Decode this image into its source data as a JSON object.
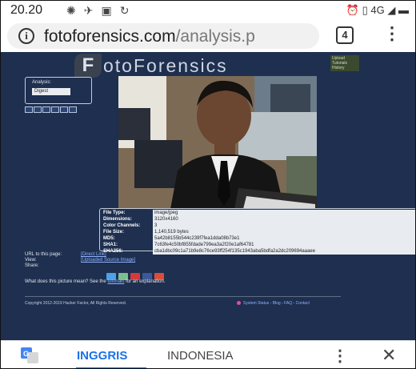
{
  "status_bar": {
    "time": "20.20",
    "network": "4G"
  },
  "address_bar": {
    "url_host": "fotoforensics.com",
    "url_path": "/analysis.p",
    "tab_count": "4"
  },
  "site": {
    "logo_letter": "F",
    "logo_word": "otoForensics",
    "top_links": [
      "Upload",
      "Tutorials",
      "History"
    ]
  },
  "analysis": {
    "label": "Analysis:",
    "selected": "Digest"
  },
  "file_info": {
    "rows": [
      {
        "key": "File Type:",
        "value": "image/jpeg"
      },
      {
        "key": "Dimensions:",
        "value": "3120x4160"
      },
      {
        "key": "Color Channels:",
        "value": "3"
      },
      {
        "key": "File Size:",
        "value": "1,140,519 bytes"
      },
      {
        "key": "MD5:",
        "value": "5a42b8155b544c239f7fea1dda08b73e1"
      },
      {
        "key": "SHA1:",
        "value": "7c63fe4c50bf855fdade799ea3a2f20e1af64781"
      },
      {
        "key": "SHA256:",
        "value": "cba1dbc09c1a71b9e8c76ce93ff254f135c1943aba5bdfa2a2dc209694aaaee"
      }
    ]
  },
  "links": {
    "url_label": "URL to this page:",
    "url_link": "[Direct Link]",
    "view_label": "View:",
    "view_link": "[Uploaded Source Image]",
    "share_label": "Share:",
    "share_icons": [
      {
        "name": "twitter",
        "color": "#4aa3e8"
      },
      {
        "name": "email",
        "color": "#7bbf8e"
      },
      {
        "name": "pinterest",
        "color": "#d43a3a"
      },
      {
        "name": "facebook",
        "color": "#3b5998"
      },
      {
        "name": "google-plus",
        "color": "#dd4b39"
      }
    ],
    "explain_prefix": "What does this picture mean? See the ",
    "explain_link": "tutorials",
    "explain_suffix": " for an explanation."
  },
  "footer": {
    "copyright": "Copyright 2012-2019 Hacker Factor, All Rights Reserved.",
    "links": [
      "System Status",
      "Blog",
      "FAQ",
      "Contact"
    ],
    "separator": " - "
  },
  "translate_bar": {
    "active_language": "INGGRIS",
    "other_language": "INDONESIA"
  },
  "colors": {
    "page_bg": "#1e2f4f",
    "link": "#8fb3ff",
    "accent": "#1a73e8"
  }
}
